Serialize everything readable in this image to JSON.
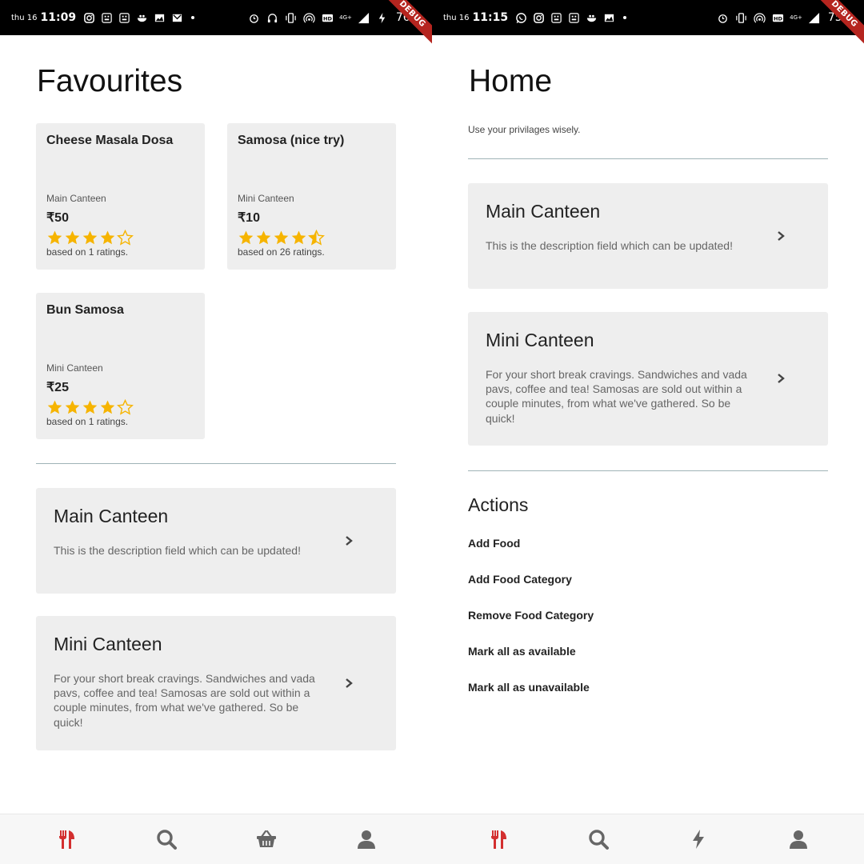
{
  "colors": {
    "active_nav": "#d32f2f",
    "inactive_nav": "#666666",
    "star": "#f6b400",
    "card_bg": "#eeeeee",
    "divider": "#9fb3b7",
    "status_bar": "#000000",
    "debug_ribbon": "#b5251f"
  },
  "left": {
    "status": {
      "day": "thu 16",
      "time": "11:09",
      "battery": "76%",
      "network": "4G+",
      "debug": "DEBUG",
      "icons": [
        "instagram-icon",
        "app-icon",
        "app-icon",
        "bowl-icon",
        "gallery-icon",
        "gmail-icon",
        "alarm-icon",
        "headphones-icon",
        "vibrate-icon",
        "hotspot-icon",
        "hd-icon",
        "signal-icon",
        "charging-icon"
      ]
    },
    "title": "Favourites",
    "food_cards": [
      {
        "name": "Cheese Masala Dosa",
        "canteen": "Main Canteen",
        "price": "₹50",
        "rating": 4,
        "ratings_text": "based on 1 ratings."
      },
      {
        "name": "Samosa (nice try)",
        "canteen": "Mini Canteen",
        "price": "₹10",
        "rating": 4.5,
        "ratings_text": "based on 26 ratings."
      },
      {
        "name": "Bun Samosa",
        "canteen": "Mini Canteen",
        "price": "₹25",
        "rating": 4,
        "ratings_text": "based on 1 ratings."
      }
    ],
    "canteens": [
      {
        "name": "Main Canteen",
        "description": "This is the description field which can be updated!"
      },
      {
        "name": "Mini Canteen",
        "description": "For your short break cravings. Sandwiches and vada pavs, coffee and tea! Samosas are sold out within a couple minutes, from what we've gathered. So be quick!"
      }
    ],
    "nav": [
      {
        "icon": "cutlery-icon",
        "active": true
      },
      {
        "icon": "search-icon",
        "active": false
      },
      {
        "icon": "basket-icon",
        "active": false
      },
      {
        "icon": "user-icon",
        "active": false
      }
    ]
  },
  "right": {
    "status": {
      "day": "thu 16",
      "time": "11:15",
      "battery": "75%",
      "network": "4G+",
      "debug": "DEBUG",
      "icons": [
        "whatsapp-icon",
        "instagram-icon",
        "app-icon",
        "app-icon",
        "bowl-icon",
        "gallery-icon",
        "alarm-icon",
        "vibrate-icon",
        "hotspot-icon",
        "hd-icon",
        "signal-icon"
      ]
    },
    "title": "Home",
    "subtitle": "Use your privilages wisely.",
    "canteens": [
      {
        "name": "Main Canteen",
        "description": "This is the description field which can be updated!"
      },
      {
        "name": "Mini Canteen",
        "description": "For your short break cravings. Sandwiches and vada pavs, coffee and tea! Samosas are sold out within a couple minutes, from what we've gathered. So be quick!"
      }
    ],
    "actions_title": "Actions",
    "actions": [
      "Add Food",
      "Add Food Category",
      "Remove Food Category",
      "Mark all as available",
      "Mark all as unavailable"
    ],
    "nav": [
      {
        "icon": "cutlery-icon",
        "active": true
      },
      {
        "icon": "search-icon",
        "active": false
      },
      {
        "icon": "bolt-icon",
        "active": false
      },
      {
        "icon": "user-icon",
        "active": false
      }
    ]
  }
}
